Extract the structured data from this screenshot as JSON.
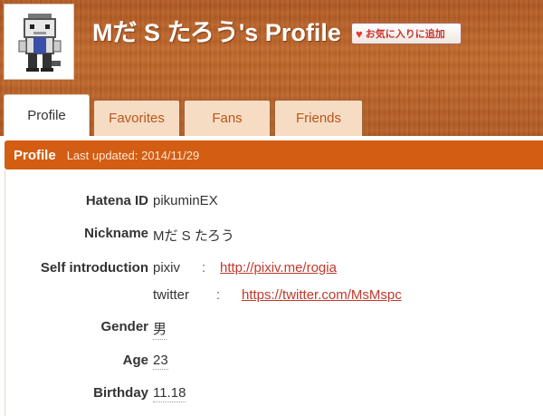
{
  "header": {
    "title": "Mだ S たろう's Profile",
    "favorite_button": "お気に入りに追加"
  },
  "tabs": [
    {
      "label": "Profile",
      "active": true
    },
    {
      "label": "Favorites",
      "active": false
    },
    {
      "label": "Fans",
      "active": false
    },
    {
      "label": "Friends",
      "active": false
    }
  ],
  "section": {
    "title": "Profile",
    "last_updated": "Last updated: 2014/11/29"
  },
  "profile": {
    "hatena_id_label": "Hatena ID",
    "hatena_id": "pikuminEX",
    "nickname_label": "Nickname",
    "nickname": "Mだ S たろう",
    "self_intro_label": "Self introduction",
    "links": [
      {
        "site": "pixiv",
        "sep": ":",
        "url": "http://pixiv.me/rogia"
      },
      {
        "site": "twitter",
        "sep": ":",
        "url": "https://twitter.com/MsMspc"
      }
    ],
    "gender_label": "Gender",
    "gender": "男",
    "age_label": "Age",
    "age": "23",
    "birthday_label": "Birthday",
    "birthday": "11.18"
  },
  "colors": {
    "header_wood": "#c46a2c",
    "section_bar": "#d35d13",
    "tab_inactive_bg": "#f6dcc3",
    "tab_inactive_text": "#b9561b",
    "link": "#c0392b"
  }
}
